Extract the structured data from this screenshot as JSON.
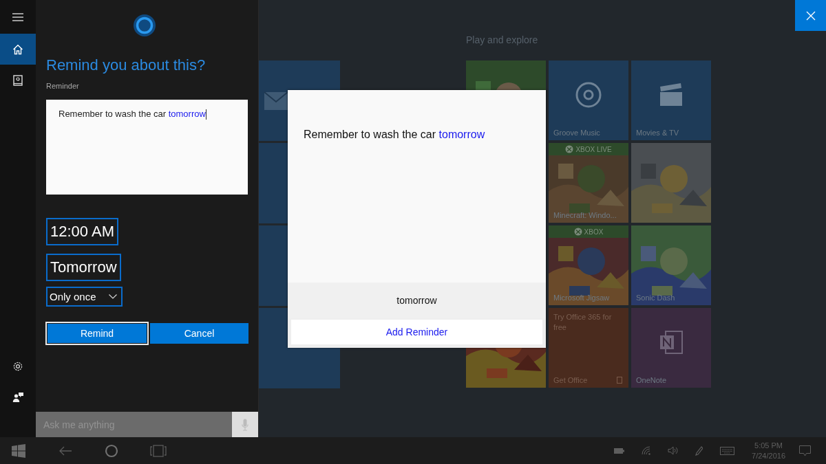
{
  "nav": {
    "items": [
      {
        "kind": "home",
        "selected": true
      },
      {
        "kind": "notebook",
        "selected": false
      }
    ],
    "bottom": [
      {
        "kind": "settings"
      },
      {
        "kind": "feedback"
      }
    ]
  },
  "cortana": {
    "title": "Remind you about this?",
    "field_label": "Reminder",
    "reminder_text": {
      "text": "Remember to wash the car",
      "highlight": "tomorrow"
    },
    "time": "12:00 AM",
    "date": "Tomorrow",
    "repeat": "Only once",
    "buttons": [
      {
        "label": "Remind",
        "focused": true
      },
      {
        "label": "Cancel",
        "focused": false
      }
    ],
    "search": {
      "placeholder": "Ask me anything"
    }
  },
  "start": {
    "group_title": "Play and explore",
    "left_tiles": [
      {
        "kind": "mail"
      },
      {
        "kind": "blank"
      },
      {
        "kind": "blank"
      },
      {
        "kind": "blank"
      }
    ],
    "tiles": [
      {
        "kind": "picture"
      },
      {
        "kind": "music",
        "label": "Groove Music"
      },
      {
        "kind": "movies",
        "label": "Movies & TV"
      },
      {
        "kind": "covered"
      },
      {
        "kind": "picture",
        "badge": "XBOX LIVE",
        "label": "Minecraft: Windo..."
      },
      {
        "kind": "picture"
      },
      {
        "kind": "covered"
      },
      {
        "kind": "picture",
        "badge": "XBOX",
        "label": "Microsoft Jigsaw"
      },
      {
        "kind": "picture",
        "label": "Sonic Dash"
      },
      {
        "kind": "picture"
      },
      {
        "kind": "office",
        "promo": "Try Office 365 for free",
        "label": "Get Office"
      },
      {
        "kind": "onenote",
        "label": "OneNote"
      }
    ]
  },
  "popup": {
    "text": "Remember to wash the car",
    "highlight": "tomorrow",
    "suggestion": "tomorrow",
    "action": "Add Reminder"
  },
  "taskbar": {
    "time": "5:05 PM",
    "date": "7/24/2016"
  }
}
